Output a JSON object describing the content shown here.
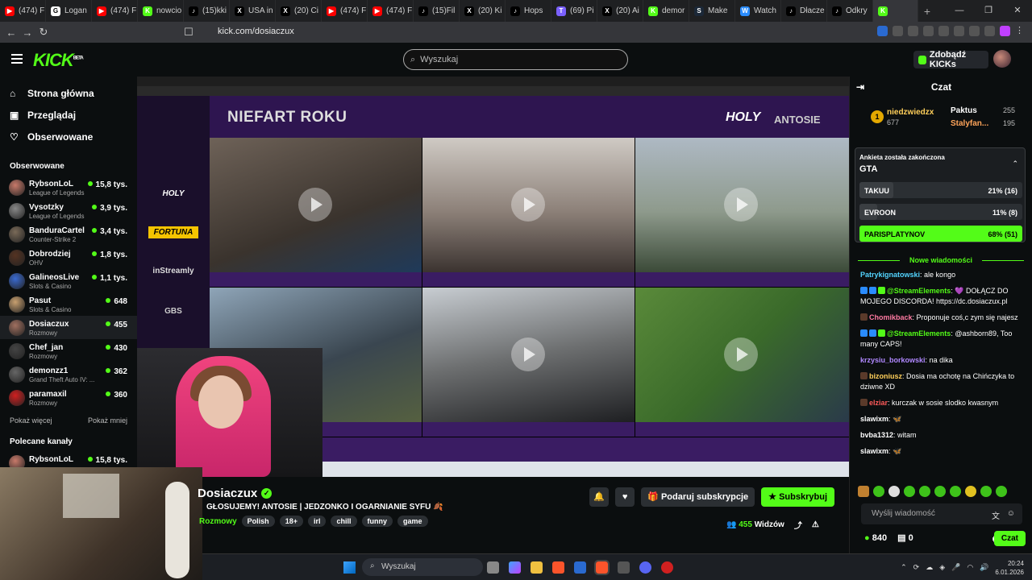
{
  "browser": {
    "tabs": [
      {
        "label": "(474) F",
        "color": "#ff0000",
        "glyph": "▶"
      },
      {
        "label": "Logan",
        "color": "#ffffff",
        "glyph": "G"
      },
      {
        "label": "(474) F",
        "color": "#ff0000",
        "glyph": "▶"
      },
      {
        "label": "nowcio",
        "color": "#53fc18",
        "glyph": "K"
      },
      {
        "label": "(15)kki",
        "color": "#000000",
        "glyph": "♪"
      },
      {
        "label": "USA in",
        "color": "#000000",
        "glyph": "X"
      },
      {
        "label": "(20) Ci",
        "color": "#000000",
        "glyph": "X"
      },
      {
        "label": "(474) F",
        "color": "#ff0000",
        "glyph": "▶"
      },
      {
        "label": "(474) F",
        "color": "#ff0000",
        "glyph": "▶"
      },
      {
        "label": "(15)Fil",
        "color": "#000000",
        "glyph": "♪"
      },
      {
        "label": "(20) Ki",
        "color": "#000000",
        "glyph": "X"
      },
      {
        "label": "Hops",
        "color": "#000000",
        "glyph": "♪"
      },
      {
        "label": "(69) Pi",
        "color": "#7b61ff",
        "glyph": "T"
      },
      {
        "label": "(20) Ai",
        "color": "#000000",
        "glyph": "X"
      },
      {
        "label": "demor",
        "color": "#53fc18",
        "glyph": "K"
      },
      {
        "label": "Make",
        "color": "#1b2838",
        "glyph": "S"
      },
      {
        "label": "Watch",
        "color": "#2a8cff",
        "glyph": "W"
      },
      {
        "label": "Dłacze",
        "color": "#000000",
        "glyph": "♪"
      },
      {
        "label": "Odkry",
        "color": "#000000",
        "glyph": "♪"
      },
      {
        "label": "",
        "color": "#53fc18",
        "glyph": "K"
      }
    ],
    "url": "kick.com/dosiaczux"
  },
  "header": {
    "logo": "KICK",
    "logo_sup": "BETA",
    "search_placeholder": "Wyszukaj",
    "kicks_button": "Zdobądź KICKs"
  },
  "sidebar": {
    "nav": [
      {
        "label": "Strona główna",
        "icon": "⌂"
      },
      {
        "label": "Przeglądaj",
        "icon": "▣"
      },
      {
        "label": "Obserwowane",
        "icon": "♡"
      }
    ],
    "followed_title": "Obserwowane",
    "followed": [
      {
        "name": "RybsonLoL",
        "category": "League of Legends",
        "viewers": "15,8 tys.",
        "color": "#c87a6a"
      },
      {
        "name": "Vysotzky",
        "category": "League of Legends",
        "viewers": "3,9 tys.",
        "color": "#888888"
      },
      {
        "name": "BanduraCartel",
        "category": "Counter-Strike 2",
        "viewers": "3,4 tys.",
        "color": "#7a6a58"
      },
      {
        "name": "Dobrodziej",
        "category": "OHV",
        "viewers": "1,8 tys.",
        "color": "#553322"
      },
      {
        "name": "GalineosLive",
        "category": "Slots & Casino",
        "viewers": "1,1 tys.",
        "color": "#3a6ad0"
      },
      {
        "name": "Pasut",
        "category": "Slots & Casino",
        "viewers": "648",
        "color": "#c8a070"
      },
      {
        "name": "Dosiaczux",
        "category": "Rozmowy",
        "viewers": "455",
        "color": "#a07060"
      },
      {
        "name": "Chef_jan",
        "category": "Rozmowy",
        "viewers": "430",
        "color": "#444444"
      },
      {
        "name": "demonzz1",
        "category": "Grand Theft Auto IV: ...",
        "viewers": "362",
        "color": "#666666"
      },
      {
        "name": "paramaxil",
        "category": "Rozmowy",
        "viewers": "360",
        "color": "#d02020"
      }
    ],
    "show_more": "Pokaż więcej",
    "show_less": "Pokaż mniej",
    "recommended_title": "Polecane kanały",
    "recommended": [
      {
        "name": "RybsonLoL",
        "viewers": "15,8 tys.",
        "color": "#c87a6a"
      }
    ]
  },
  "stream_overlay": {
    "title": "NIEFART ROKU",
    "brand_a": "HOLY",
    "brand_b": "ANTOSIE",
    "sponsors": [
      "HOLY",
      "FORTUNA",
      "inStreamly",
      "GBS"
    ]
  },
  "streamer": {
    "name": "Dosiaczux",
    "title": "GŁOSUJEMY! ANTOSIE | JEDZONKO I OGARNIANIE SYFU 🍂",
    "category": "Rozmowy",
    "tags": [
      "Polish",
      "18+",
      "irl",
      "chill",
      "funny",
      "game"
    ],
    "viewers": "455",
    "viewers_label": "Widzów",
    "gift_button": "Podaruj subskrypcje",
    "subscribe_button": "Subskrybuj"
  },
  "chat": {
    "title": "Czat",
    "leaderboard": [
      {
        "rank": "1",
        "name": "niedzwiedzx",
        "points": "677"
      },
      {
        "name": "Paktus",
        "points": "255"
      },
      {
        "name": "Stalyfan...",
        "points": "195"
      }
    ],
    "poll": {
      "header": "Ankieta została zakończona",
      "question": "GTA",
      "options": [
        {
          "label": "TAKUU",
          "result": "21% (16)",
          "share": 0.21,
          "color": "#3a3e42"
        },
        {
          "label": "EVROON",
          "result": "11% (8)",
          "share": 0.11,
          "color": "#3a3e42"
        },
        {
          "label": "PARISPLATYNOV",
          "result": "68% (51)",
          "share": 1.0,
          "color": "#53fc18"
        }
      ]
    },
    "new_messages": "Nowe wiadomości",
    "messages": [
      {
        "user": "Patrykignatowski",
        "color": "#53d4ff",
        "text": "ale kongo",
        "badges": []
      },
      {
        "user": "@StreamElements",
        "color": "#53fc18",
        "text": "💜 DOŁĄCZ DO MOJEGO DISCORDA! https://dc.dosiaczux.pl",
        "badges": [
          "#2a8cff",
          "#2a8cff",
          "#53fc18"
        ]
      },
      {
        "user": "Chomikback",
        "color": "#ff7aa2",
        "text": "Proponuje coś,c zym się najesz",
        "badges": [
          "#5a3a2a"
        ]
      },
      {
        "user": "@StreamElements",
        "color": "#53fc18",
        "text": "@ashborn89, Too many CAPS!",
        "badges": [
          "#2a8cff",
          "#2a8cff",
          "#53fc18"
        ]
      },
      {
        "user": "krzysiu_borkowski",
        "color": "#b088ff",
        "text": "na dika",
        "badges": []
      },
      {
        "user": "bizoniusz",
        "color": "#ffcf5a",
        "text": "Dosia ma ochotę na Chińczyka to dziwne XD",
        "badges": [
          "#5a3a2a"
        ]
      },
      {
        "user": "elziar",
        "color": "#ff5a5a",
        "text": "kurczak w sosie slodko kwasnym",
        "badges": [
          "#5a3a2a"
        ]
      },
      {
        "user": "slawixm",
        "color": "#ffffff",
        "text": "🦋",
        "badges": []
      },
      {
        "user": "bvba1312",
        "color": "#ffffff",
        "text": "witam",
        "badges": []
      },
      {
        "user": "slawixm",
        "color": "#ffffff",
        "text": "🦋",
        "badges": []
      }
    ],
    "input_placeholder": "Wyślij wiadomość",
    "points": "840",
    "subs": "0",
    "send_button": "Czat"
  },
  "taskbar": {
    "search": "Wyszukaj",
    "time": "20:24",
    "date": "6.01.2026"
  }
}
